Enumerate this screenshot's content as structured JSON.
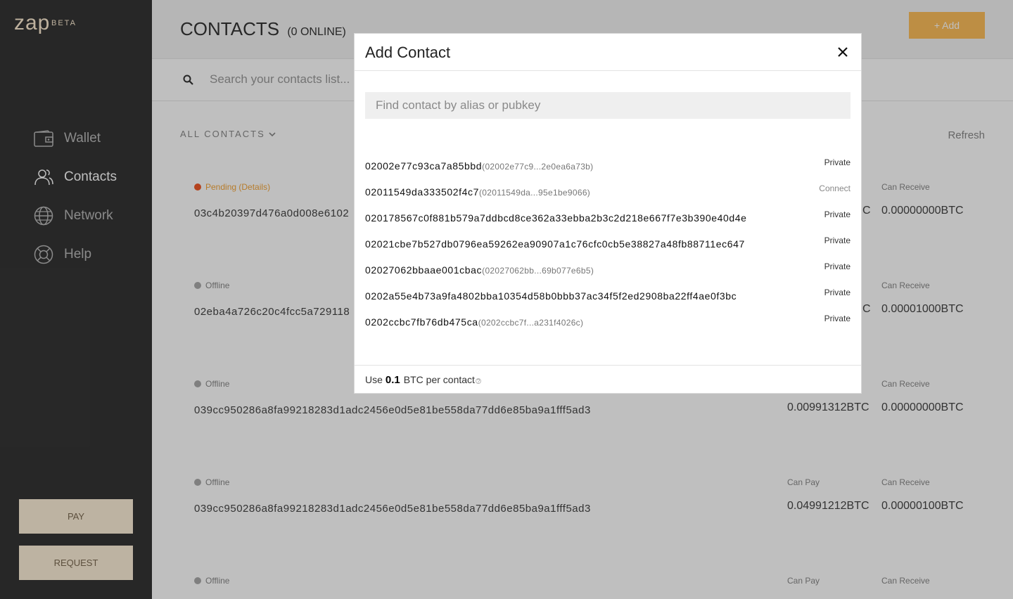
{
  "app": {
    "logo": "zap",
    "beta": "BETA"
  },
  "sidebar": {
    "items": [
      {
        "label": "Wallet",
        "icon": "wallet-icon"
      },
      {
        "label": "Contacts",
        "icon": "contacts-icon",
        "active": true
      },
      {
        "label": "Network",
        "icon": "globe-icon"
      },
      {
        "label": "Help",
        "icon": "lifebuoy-icon"
      }
    ],
    "pay_label": "PAY",
    "request_label": "REQUEST"
  },
  "header": {
    "title": "CONTACTS",
    "online": "(0 ONLINE)",
    "add_label": "+ Add"
  },
  "search": {
    "placeholder": "Search your contacts list..."
  },
  "filter": {
    "label": "ALL CONTACTS"
  },
  "refresh_label": "Refresh",
  "contacts": [
    {
      "status": "Pending",
      "details": "(Details)",
      "pubkey": "03c4b20397d476a0d008e6102",
      "can_pay_label": "",
      "can_pay": "C",
      "can_receive_label": "Can Receive",
      "can_receive": "0.00000000BTC"
    },
    {
      "status": "Offline",
      "pubkey": "02eba4a726c20c4fcc5a729118",
      "can_pay_label": "",
      "can_pay": "C",
      "can_receive_label": "Can Receive",
      "can_receive": "0.00001000BTC"
    },
    {
      "status": "Offline",
      "pubkey": "039cc950286a8fa99218283d1adc2456e0d5e81be558da77dd6e85ba9a1fff5ad3",
      "can_pay_label": "",
      "can_pay": "0.00991312BTC",
      "can_receive_label": "Can Receive",
      "can_receive": "0.00000000BTC"
    },
    {
      "status": "Offline",
      "pubkey": "039cc950286a8fa99218283d1adc2456e0d5e81be558da77dd6e85ba9a1fff5ad3",
      "can_pay_label": "Can Pay",
      "can_pay": "0.04991212BTC",
      "can_receive_label": "Can Receive",
      "can_receive": "0.00000100BTC"
    },
    {
      "status": "Offline",
      "pubkey": "",
      "can_pay_label": "Can Pay",
      "can_pay": "",
      "can_receive_label": "Can Receive",
      "can_receive": ""
    }
  ],
  "modal": {
    "title": "Add Contact",
    "search_placeholder": "Find contact by alias or pubkey",
    "nodes": [
      {
        "key": "02002e77c93ca7a85bbd",
        "short": "(02002e77c9...2e0ea6a73b)",
        "action": "Private"
      },
      {
        "key": "02011549da333502f4c7",
        "short": "(02011549da...95e1be9066)",
        "action": "Connect"
      },
      {
        "key": "020178567c0f881b579a7ddbcd8ce362a33ebba2b3c2d218e667f7e3b390e40d4e",
        "short": "",
        "action": "Private"
      },
      {
        "key": "02021cbe7b527db0796ea59262ea90907a1c76cfc0cb5e38827a48fb88711ec647",
        "short": "",
        "action": "Private"
      },
      {
        "key": "02027062bbaae001cbac",
        "short": "(02027062bb...69b077e6b5)",
        "action": "Private"
      },
      {
        "key": "0202a55e4b73a9fa4802bba10354d58b0bbb37ac34f5f2ed2908ba22ff4ae0f3bc",
        "short": "",
        "action": "Private"
      },
      {
        "key": "0202ccbc7fb76db475ca",
        "short": "(0202ccbc7f...a231f4026c)",
        "action": "Private"
      }
    ],
    "footer": {
      "prefix": "Use",
      "amount": "0.1",
      "suffix": "BTC per contact",
      "help": "?"
    }
  }
}
